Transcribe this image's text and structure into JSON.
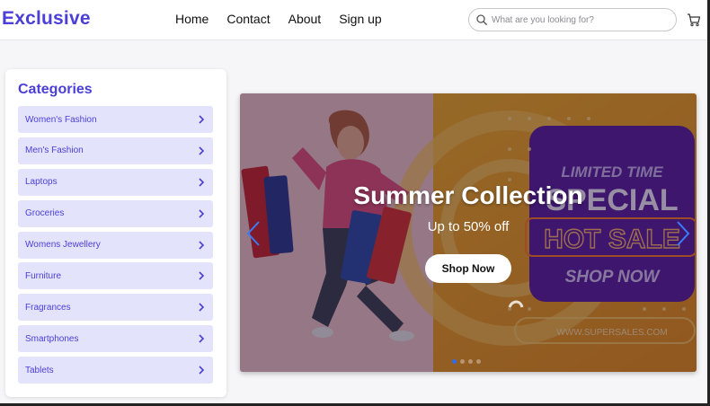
{
  "header": {
    "logo": "Exclusive",
    "nav": [
      "Home",
      "Contact",
      "About",
      "Sign up"
    ],
    "search_placeholder": "What are you looking for?",
    "icons": {
      "search": "search-icon",
      "cart": "cart-icon"
    }
  },
  "sidebar": {
    "title": "Categories",
    "items": [
      "Women's Fashion",
      "Men's Fashion",
      "Laptops",
      "Groceries",
      "Womens Jewellery",
      "Furniture",
      "Fragrances",
      "Smartphones",
      "Tablets"
    ]
  },
  "banner": {
    "title": "Summer Collection",
    "subtitle": "Up to 50% off",
    "button": "Shop Now",
    "image_text": {
      "line1": "LIMITED TIME",
      "line2": "SPECIAL",
      "line3": "HOT SALE",
      "line4": "SHOP NOW",
      "url": "WWW.SUPERSALES.COM"
    },
    "slide_count": 4,
    "active_slide": 1
  },
  "colors": {
    "brand": "#4b3fd8",
    "category_bg": "#e3e3fb",
    "banner_orange": "#f2a51c",
    "banner_purple": "#5a1fa0",
    "active_dot": "#2f6cf0"
  }
}
